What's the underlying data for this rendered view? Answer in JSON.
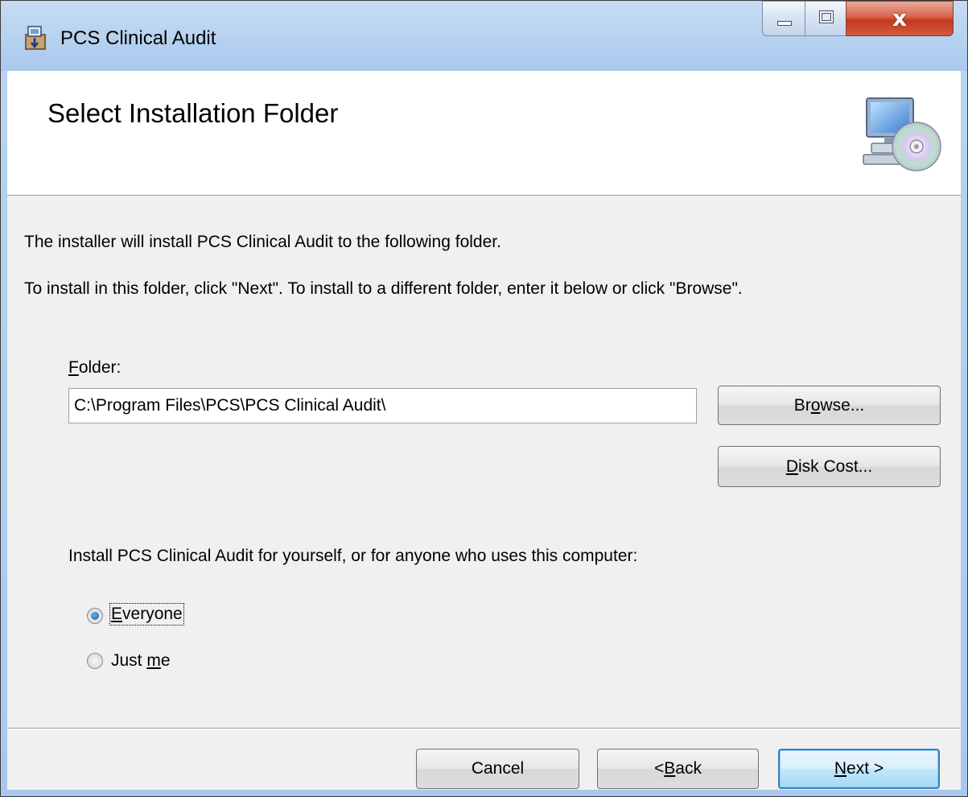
{
  "window": {
    "title": "PCS Clinical Audit",
    "app_icon": "installer-package-icon"
  },
  "banner": {
    "heading": "Select Installation Folder",
    "icon": "computer-disc-icon"
  },
  "intro": {
    "line1": "The installer will install PCS Clinical Audit to the following folder.",
    "line2": "To install in this folder, click \"Next\". To install to a different folder, enter it below or click \"Browse\"."
  },
  "folder": {
    "label_first": "F",
    "label_rest": "older:",
    "value": "C:\\Program Files\\PCS\\PCS Clinical Audit\\"
  },
  "buttons": {
    "browse_pre": "Br",
    "browse_ul": "o",
    "browse_post": "wse...",
    "disk_cost_ul": "D",
    "disk_cost_post": "isk Cost...",
    "cancel": "Cancel",
    "back_pre": "< ",
    "back_ul": "B",
    "back_post": "ack",
    "next_ul": "N",
    "next_post": "ext >"
  },
  "scope": {
    "prompt": "Install PCS Clinical Audit for yourself, or for anyone who uses this computer:",
    "options": [
      {
        "ul": "E",
        "rest": "veryone",
        "selected": true
      },
      {
        "pre": "Just ",
        "ul": "m",
        "rest": "e",
        "selected": false
      }
    ]
  },
  "colors": {
    "title_bar": "#b9d3f0",
    "close_button": "#c43a20",
    "default_button_border": "#3c7fb1"
  }
}
